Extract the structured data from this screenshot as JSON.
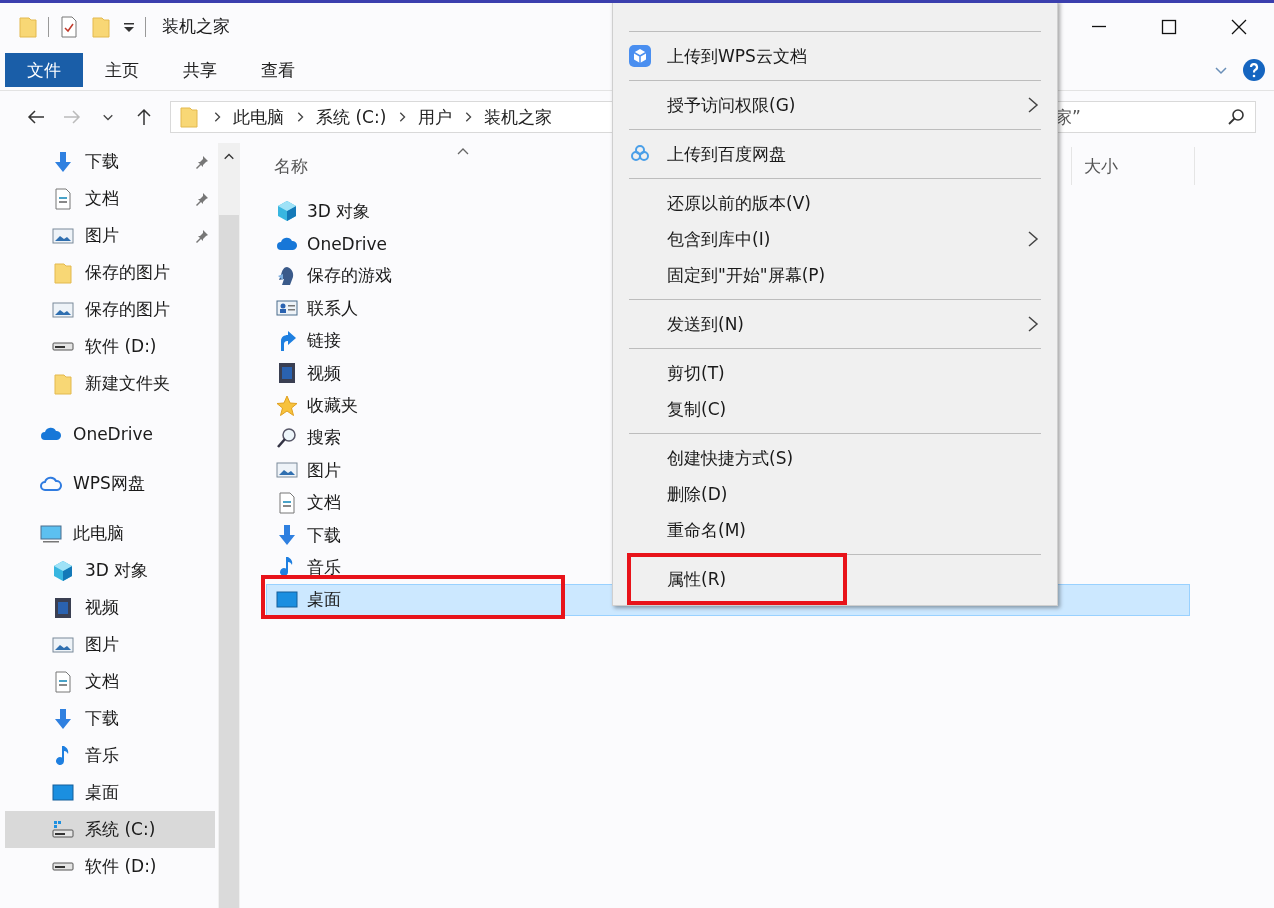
{
  "window": {
    "title": "装机之家"
  },
  "ribbon": {
    "tabs": [
      {
        "label": "文件",
        "selected": true
      },
      {
        "label": "主页",
        "selected": false
      },
      {
        "label": "共享",
        "selected": false
      },
      {
        "label": "查看",
        "selected": false
      }
    ]
  },
  "address": {
    "path": [
      "此电脑",
      "系统 (C:)",
      "用户",
      "装机之家"
    ]
  },
  "search": {
    "value": "家”"
  },
  "nav": {
    "quick_access_items": [
      {
        "label": "下载",
        "kind": "download",
        "pinned": true,
        "selected": false
      },
      {
        "label": "文档",
        "kind": "document",
        "pinned": true,
        "selected": false
      },
      {
        "label": "图片",
        "kind": "picture",
        "pinned": true,
        "selected": false
      },
      {
        "label": "保存的图片",
        "kind": "folder",
        "pinned": false,
        "selected": false
      },
      {
        "label": "保存的图片",
        "kind": "picture",
        "pinned": false,
        "selected": false
      },
      {
        "label": "软件 (D:)",
        "kind": "drive",
        "pinned": false,
        "selected": false
      },
      {
        "label": "新建文件夹",
        "kind": "folder",
        "pinned": false,
        "selected": false
      }
    ],
    "items": [
      {
        "label": "OneDrive",
        "kind": "onedrive",
        "selected": false
      },
      {
        "label": "WPS网盘",
        "kind": "wpscloud",
        "selected": false
      },
      {
        "label": "此电脑",
        "kind": "pc",
        "selected": false,
        "children": [
          {
            "label": "3D 对象",
            "kind": "cube",
            "selected": false
          },
          {
            "label": "视频",
            "kind": "video",
            "selected": false
          },
          {
            "label": "图片",
            "kind": "picture",
            "selected": false
          },
          {
            "label": "文档",
            "kind": "document",
            "selected": false
          },
          {
            "label": "下载",
            "kind": "download",
            "selected": false
          },
          {
            "label": "音乐",
            "kind": "music",
            "selected": false
          },
          {
            "label": "桌面",
            "kind": "desktop",
            "selected": false
          },
          {
            "label": "系统 (C:)",
            "kind": "sysdrive",
            "selected": true
          },
          {
            "label": "软件 (D:)",
            "kind": "drive",
            "selected": false
          }
        ]
      }
    ]
  },
  "table": {
    "columns": [
      {
        "label": "名称",
        "sorted": true
      },
      {
        "label": "大小",
        "sorted": false
      }
    ],
    "rows": [
      {
        "name": "3D 对象",
        "kind": "cube",
        "selected": false,
        "annotated": false
      },
      {
        "name": "OneDrive",
        "kind": "onedrive",
        "selected": false,
        "annotated": false
      },
      {
        "name": "保存的游戏",
        "kind": "games",
        "selected": false,
        "annotated": false
      },
      {
        "name": "联系人",
        "kind": "contacts",
        "selected": false,
        "annotated": false
      },
      {
        "name": "链接",
        "kind": "link",
        "selected": false,
        "annotated": false
      },
      {
        "name": "视频",
        "kind": "video",
        "selected": false,
        "annotated": false
      },
      {
        "name": "收藏夹",
        "kind": "star",
        "selected": false,
        "annotated": false
      },
      {
        "name": "搜索",
        "kind": "search",
        "selected": false,
        "annotated": false
      },
      {
        "name": "图片",
        "kind": "picture",
        "selected": false,
        "annotated": false
      },
      {
        "name": "文档",
        "kind": "document",
        "selected": false,
        "annotated": false
      },
      {
        "name": "下载",
        "kind": "download",
        "selected": false,
        "annotated": false
      },
      {
        "name": "音乐",
        "kind": "music",
        "selected": false,
        "annotated": false
      },
      {
        "name": "桌面",
        "kind": "desktop",
        "selected": true,
        "annotated": true
      }
    ]
  },
  "context_menu": {
    "items": [
      {
        "kind": "separator"
      },
      {
        "kind": "wpsupload",
        "label": "上传到WPS云文档",
        "annotated": false
      },
      {
        "kind": "separator"
      },
      {
        "kind": "submenu",
        "label": "授予访问权限(G)",
        "annotated": false
      },
      {
        "kind": "separator"
      },
      {
        "kind": "baiduupload",
        "label": "上传到百度网盘",
        "annotated": false
      },
      {
        "kind": "separator"
      },
      {
        "kind": "command",
        "label": "还原以前的版本(V)",
        "annotated": false
      },
      {
        "kind": "submenu",
        "label": "包含到库中(I)",
        "annotated": false
      },
      {
        "kind": "command",
        "label": "固定到\"开始\"屏幕(P)",
        "annotated": false
      },
      {
        "kind": "separator"
      },
      {
        "kind": "submenu",
        "label": "发送到(N)",
        "annotated": false
      },
      {
        "kind": "separator"
      },
      {
        "kind": "command",
        "label": "剪切(T)",
        "annotated": false
      },
      {
        "kind": "command",
        "label": "复制(C)",
        "annotated": false
      },
      {
        "kind": "separator"
      },
      {
        "kind": "command",
        "label": "创建快捷方式(S)",
        "annotated": false
      },
      {
        "kind": "command",
        "label": "删除(D)",
        "annotated": false
      },
      {
        "kind": "command",
        "label": "重命名(M)",
        "annotated": false
      },
      {
        "kind": "separator"
      },
      {
        "kind": "command",
        "label": "属性(R)",
        "annotated": true
      }
    ]
  }
}
